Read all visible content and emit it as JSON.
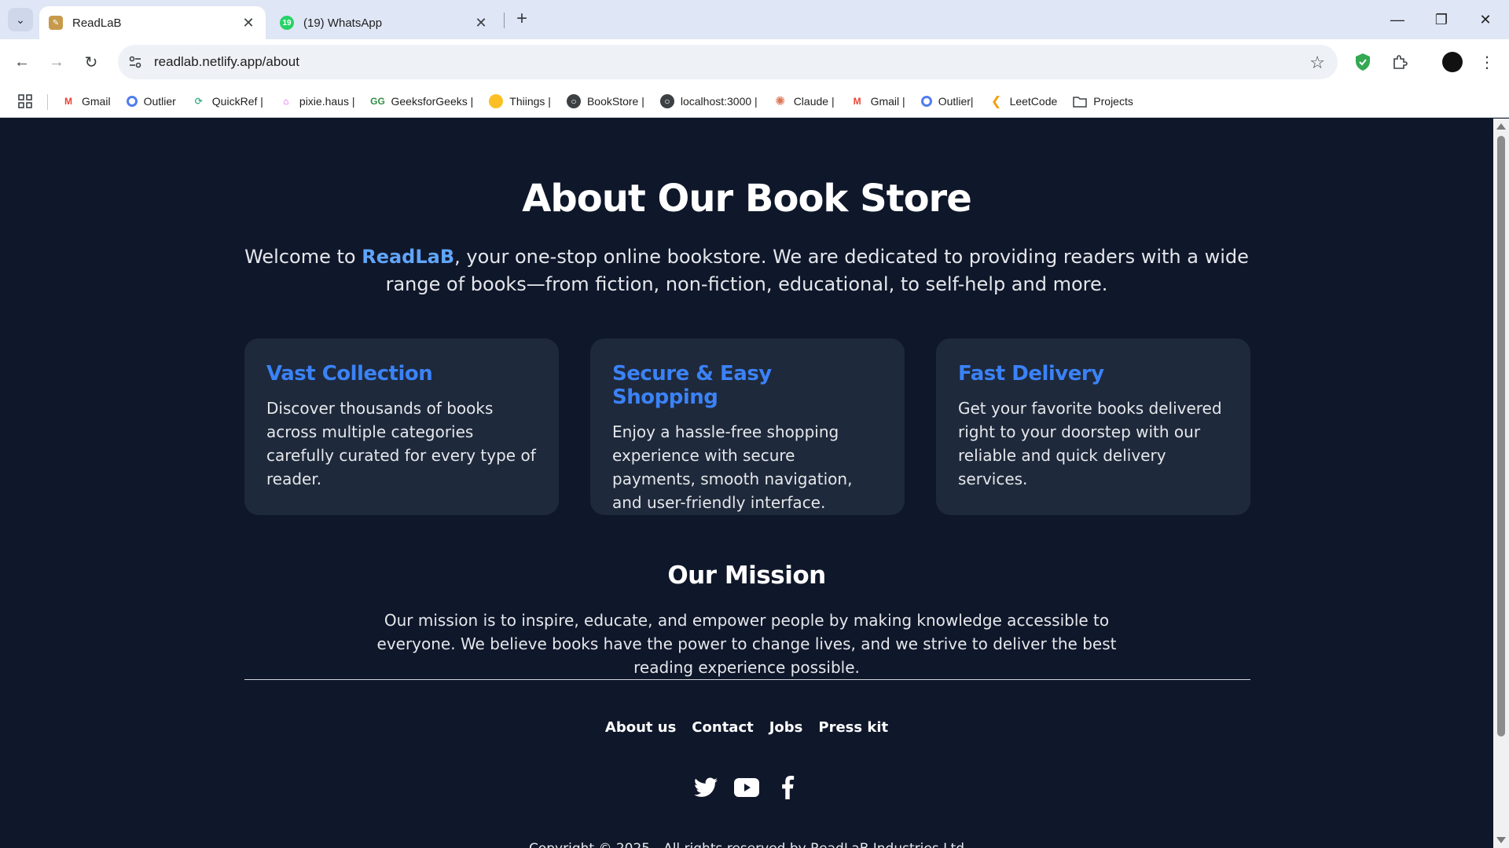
{
  "browser": {
    "tabs": [
      {
        "title": "ReadLaB",
        "active": true
      },
      {
        "title": "(19) WhatsApp",
        "active": false,
        "badge": "19"
      }
    ],
    "url": "readlab.netlify.app/about",
    "bookmarks": [
      {
        "label": "Gmail",
        "icon": "gmail-icon"
      },
      {
        "label": "Outlier",
        "icon": "outlier-icon"
      },
      {
        "label": "QuickRef |",
        "icon": "quickref-icon"
      },
      {
        "label": "pixie.haus |",
        "icon": "pixie-icon"
      },
      {
        "label": "GeeksforGeeks |",
        "icon": "gfg-icon"
      },
      {
        "label": "Thiings |",
        "icon": "thiings-icon"
      },
      {
        "label": "BookStore |",
        "icon": "globe-icon"
      },
      {
        "label": "localhost:3000 |",
        "icon": "globe-icon"
      },
      {
        "label": "Claude |",
        "icon": "claude-icon"
      },
      {
        "label": "Gmail |",
        "icon": "gmail-icon"
      },
      {
        "label": "Outlier|",
        "icon": "outlier-icon"
      },
      {
        "label": "LeetCode",
        "icon": "leetcode-icon"
      },
      {
        "label": "Projects",
        "icon": "folder-icon"
      }
    ]
  },
  "page": {
    "title": "About Our Book Store",
    "intro_prefix": "Welcome to ",
    "intro_brand": "ReadLaB",
    "intro_suffix": ", your one-stop online bookstore. We are dedicated to providing readers with a wide range of books—from fiction, non-fiction, educational, to self-help and more.",
    "features": [
      {
        "title": "Vast Collection",
        "text": "Discover thousands of books across multiple categories carefully curated for every type of reader."
      },
      {
        "title": "Secure & Easy Shopping",
        "text": "Enjoy a hassle-free shopping experience with secure payments, smooth navigation, and user-friendly interface."
      },
      {
        "title": "Fast Delivery",
        "text": "Get your favorite books delivered right to your doorstep with our reliable and quick delivery services."
      }
    ],
    "mission_title": "Our Mission",
    "mission_text": "Our mission is to inspire, educate, and empower people by making knowledge accessible to everyone. We believe books have the power to change lives, and we strive to deliver the best reading experience possible."
  },
  "footer": {
    "links": [
      "About us",
      "Contact",
      "Jobs",
      "Press kit"
    ],
    "socials": [
      "twitter-icon",
      "youtube-icon",
      "facebook-icon"
    ],
    "copyright": "Copyright © 2025 - All rights reserved by ReadLaB Industries Ltd"
  },
  "colors": {
    "page_bg": "#0f172a",
    "card_bg": "#1e293b",
    "accent": "#3b82f6",
    "brand": "#60a5fa"
  }
}
